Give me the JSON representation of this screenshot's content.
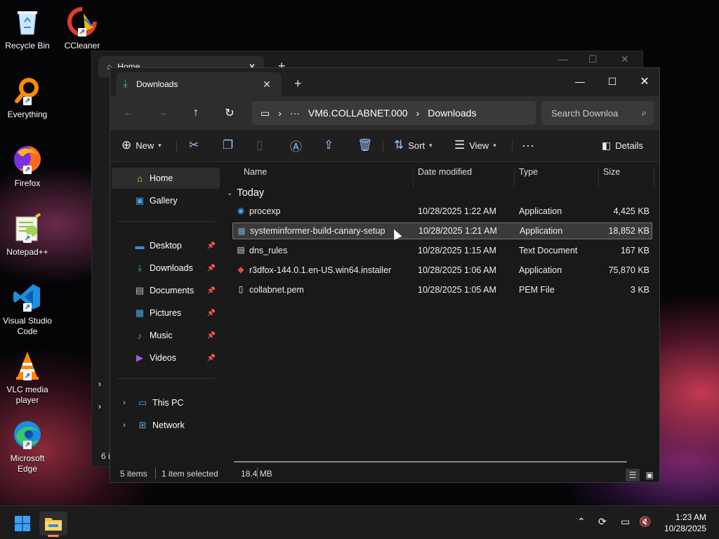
{
  "desktop": {
    "icons": [
      {
        "label": "Recycle Bin",
        "icon": "recycle-bin-icon"
      },
      {
        "label": "CCleaner",
        "icon": "ccleaner-icon"
      },
      {
        "label": "Everything",
        "icon": "everything-search-icon"
      },
      {
        "label": "Firefox",
        "icon": "firefox-icon"
      },
      {
        "label": "Notepad++",
        "icon": "notepad-plus-plus-icon"
      },
      {
        "label": "Visual Studio Code",
        "icon": "vscode-icon"
      },
      {
        "label": "VLC media player",
        "icon": "vlc-icon"
      },
      {
        "label": "Microsoft Edge",
        "icon": "edge-icon"
      }
    ]
  },
  "back_window": {
    "tab_label": "Home",
    "status_partial": "6 i"
  },
  "window": {
    "tab_label": "Downloads",
    "address": {
      "segments": [
        "VM6.COLLABNET.000",
        "Downloads"
      ]
    },
    "search": {
      "placeholder": "Search Downloa"
    },
    "toolbar": {
      "new_label": "New",
      "sort_label": "Sort",
      "view_label": "View",
      "details_label": "Details"
    },
    "sidebar": {
      "home": "Home",
      "gallery": "Gallery",
      "quick": [
        {
          "label": "Desktop",
          "icon": "desktop-icon",
          "color": "#3b8ee0"
        },
        {
          "label": "Downloads",
          "icon": "download-icon",
          "color": "#3fb08a"
        },
        {
          "label": "Documents",
          "icon": "documents-icon",
          "color": "#8a8a8a"
        },
        {
          "label": "Pictures",
          "icon": "pictures-icon",
          "color": "#4aa3e8"
        },
        {
          "label": "Music",
          "icon": "music-icon",
          "color": "#e5677a"
        },
        {
          "label": "Videos",
          "icon": "videos-icon",
          "color": "#9b5de5"
        }
      ],
      "this_pc": "This PC",
      "network": "Network"
    },
    "columns": {
      "name": "Name",
      "date": "Date modified",
      "type": "Type",
      "size": "Size"
    },
    "group_label": "Today",
    "files": [
      {
        "name": "procexp",
        "date": "10/28/2025 1:22 AM",
        "type": "Application",
        "size": "4,425 KB",
        "icon": "procexp-icon",
        "selected": false
      },
      {
        "name": "systeminformer-build-canary-setup",
        "date": "10/28/2025 1:21 AM",
        "type": "Application",
        "size": "18,852 KB",
        "icon": "systeminformer-icon",
        "selected": true
      },
      {
        "name": "dns_rules",
        "date": "10/28/2025 1:15 AM",
        "type": "Text Document",
        "size": "167 KB",
        "icon": "text-file-icon",
        "selected": false
      },
      {
        "name": "r3dfox-144.0.1.en-US.win64.installer",
        "date": "10/28/2025 1:06 AM",
        "type": "Application",
        "size": "75,870 KB",
        "icon": "r3dfox-icon",
        "selected": false
      },
      {
        "name": "collabnet.pem",
        "date": "10/28/2025 1:05 AM",
        "type": "PEM File",
        "size": "3 KB",
        "icon": "file-icon",
        "selected": false
      }
    ],
    "status": {
      "items": "5 items",
      "selected": "1 item selected",
      "size": "18.4 MB"
    }
  },
  "taskbar": {
    "time": "1:23 AM",
    "date": "10/28/2025"
  }
}
